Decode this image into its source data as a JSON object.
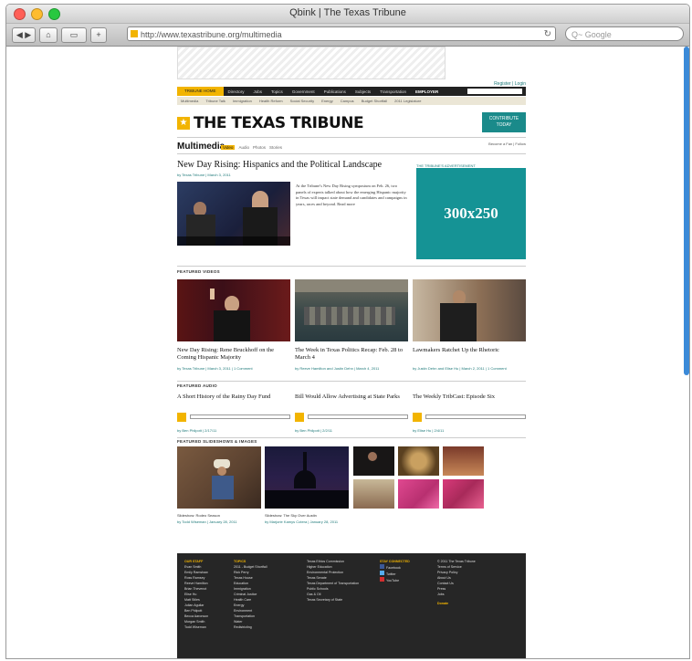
{
  "window": {
    "title": "Qbink | The Texas Tribune"
  },
  "toolbar": {
    "url": "http://www.texastribune.org/multimedia",
    "search_placeholder": "Q~ Google"
  },
  "site": {
    "register_links": "Register | Login",
    "nav": [
      "TRIBUNE HOME",
      "Directory",
      "Jobs",
      "Topics",
      "Government",
      "Publications",
      "Subjects",
      "Transportation",
      "EMPLOYER"
    ],
    "subnav": [
      "Multimedia",
      "Tribune Talk",
      "Immigration",
      "Health Reform",
      "Social Security",
      "Energy",
      "Campus",
      "Budget Shortfall",
      "2011 Legislature"
    ],
    "logo": "THE TEXAS TRIBUNE",
    "donate": "CONTRIBUTE TODAY"
  },
  "multimedia": {
    "title": "Multimedia",
    "tabs": [
      "Video",
      "Audio",
      "Photos",
      "Stories"
    ],
    "social": "Become a Fan  |  Follow"
  },
  "lead": {
    "headline": "New Day Rising: Hispanics and the Political Landscape",
    "byline": "by Texas Tribune | March 3, 2011",
    "text": "At the Tribune's New Day Rising symposium on Feb. 26, two panels of experts talked about how the emerging Hispanic majority in Texas will impact state demand and candidates and campaigns in years, races and beyond.  Read more"
  },
  "ad": {
    "label": "THE TRIBUNE'S ADVERTISEMENT",
    "size_text": "300x250"
  },
  "featured_videos": {
    "heading": "FEATURED VIDEOS",
    "items": [
      {
        "title": "New Day Rising: Rene Bruckhoff on the Coming Hispanic Majority",
        "byline": "by Texas Tribune | March 3, 2011 | 1 Comment"
      },
      {
        "title": "The Week in Texas Politics Recap: Feb. 28 to March 4",
        "byline": "by Reeve Hamilton and Justin Dehn | March 4, 2011"
      },
      {
        "title": "Lawmakers Ratchet Up the Rhetoric",
        "byline": "by Justin Dehn and Elise Hu | March 2, 2011 | 1 Comment"
      }
    ]
  },
  "featured_audio": {
    "heading": "FEATURED AUDIO",
    "items": [
      {
        "title": "A Short History of the Rainy Day Fund",
        "byline": "by Ben Philpott | 2/17/11"
      },
      {
        "title": "Bill Would Allow Advertising at State Parks",
        "byline": "by Ben Philpott | 2/2/11"
      },
      {
        "title": "The Weekly TribCast: Episode Six",
        "byline": "by Elise Hu | 2/4/11"
      }
    ]
  },
  "featured_slideshows": {
    "heading": "FEATURED SLIDESHOWS & IMAGES",
    "items": [
      {
        "caption": "Slideshow: Rodeo Season",
        "byline": "by Todd Wiseman | January 28, 2011"
      },
      {
        "caption": "Slideshow: The Sky Over Austin",
        "byline": "by Marjorie Kamys Cotera | January 28, 2011"
      }
    ]
  },
  "footer": {
    "columns": [
      {
        "heading": "OUR STAFF",
        "items": [
          "Evan Smith",
          "Emily Ramshaw",
          "Ross Ramsey",
          "Reeve Hamilton",
          "Brian Thevenot",
          "Elise Hu",
          "Matt Stiles",
          "Julian Aguilar",
          "Ben Philpott",
          "Becca Aaronson",
          "Morgan Smith",
          "Todd Wiseman"
        ]
      },
      {
        "heading": "TOPICS",
        "items": [
          "2011 - Budget Shortfall",
          "Rick Perry",
          "Texas House",
          "Education",
          "Immigration",
          "Criminal Justice",
          "Health Care",
          "Energy",
          "Environment",
          "Transportation",
          "Water",
          "Redistricting"
        ]
      },
      {
        "heading": "",
        "items": [
          "Texas Ethics Commission",
          "Higher Education",
          "Environmental Protection",
          "Texas Senate",
          "Texas Department of Transportation",
          "Public Schools",
          "Gas & Oil",
          "Texas Secretary of State"
        ]
      },
      {
        "heading": "STAY CONNECTED",
        "items": [
          "Facebook",
          "Twitter",
          "YouTube"
        ]
      },
      {
        "heading": "",
        "items": [
          "© 2011 The Texas Tribune",
          "Terms of Service",
          "Privacy Policy",
          "About Us",
          "Contact Us",
          "Press",
          "Jobs"
        ],
        "donate": "Donate"
      }
    ]
  }
}
